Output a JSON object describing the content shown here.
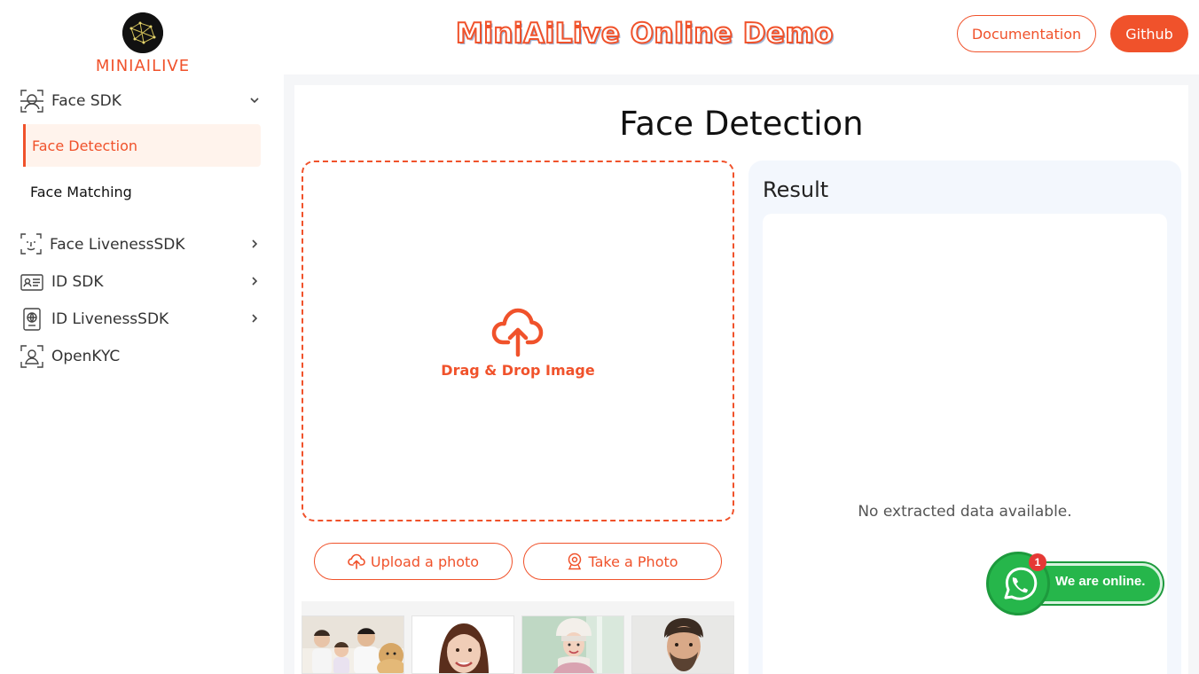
{
  "brand": {
    "logo_text": "MINIAILIVE",
    "accent": "#f0522b"
  },
  "header": {
    "title": "MiniAiLive Online Demo",
    "documentation_label": "Documentation",
    "github_label": "Github"
  },
  "sidebar": {
    "items": [
      {
        "label": "Face SDK",
        "icon": "face-scan-icon",
        "expanded": true
      },
      {
        "label": "Face Detection",
        "active": true
      },
      {
        "label": "Face Matching"
      },
      {
        "label": "Face LivenessSDK",
        "icon": "face-liveness-icon"
      },
      {
        "label": "ID SDK",
        "icon": "id-card-icon"
      },
      {
        "label": "ID LivenessSDK",
        "icon": "passport-icon"
      },
      {
        "label": "OpenKYC",
        "icon": "user-frame-icon"
      }
    ]
  },
  "main": {
    "page_title": "Face Detection",
    "dropzone_label": "Drag & Drop Image",
    "upload_label": "Upload a photo",
    "take_photo_label": "Take a Photo",
    "result_title": "Result",
    "no_data": "No extracted data available."
  },
  "whatsapp": {
    "text": "We are online.",
    "badge": "1"
  }
}
